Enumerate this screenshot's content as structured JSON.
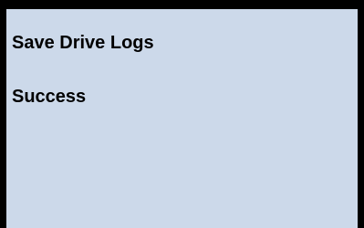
{
  "screen": {
    "title": "Save Drive Logs",
    "status": "Success",
    "background_color": "#ccd9ea",
    "border_color": "#000000"
  }
}
